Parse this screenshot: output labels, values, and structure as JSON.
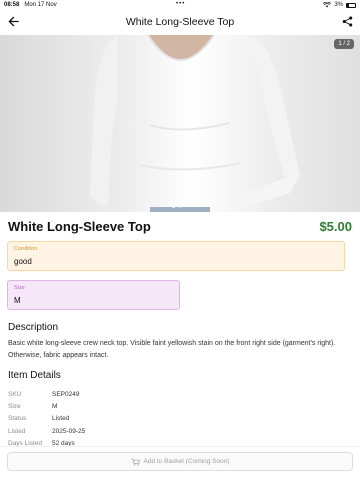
{
  "status_bar": {
    "time": "08:58",
    "date": "Mon 17 Nov",
    "dots": "•••",
    "battery": "3%"
  },
  "app_bar": {
    "title": "White Long-Sleeve Top",
    "back_icon": "arrow-left-icon",
    "share_icon": "share-icon"
  },
  "gallery": {
    "counter": "1 / 2",
    "image_subject": "white long-sleeve crew neck top worn by model"
  },
  "product": {
    "name": "White Long-Sleeve Top",
    "price": "$5.00",
    "price_color": "#2e7d32"
  },
  "condition": {
    "label": "Condition",
    "value": "good"
  },
  "size": {
    "label": "Size",
    "value": "M"
  },
  "description": {
    "title": "Description",
    "text": "Basic white long-sleeve crew neck top. Visible faint yellowish stain on the front right side (garment's right). Otherwise, fabric appears intact."
  },
  "item_details": {
    "title": "Item Details",
    "rows": [
      {
        "key": "SKU",
        "value": "SEP0249"
      },
      {
        "key": "Size",
        "value": "M"
      },
      {
        "key": "Status",
        "value": "Listed"
      },
      {
        "key": "Listed",
        "value": "2025-09-25"
      },
      {
        "key": "Days Listed",
        "value": "52 days"
      }
    ]
  },
  "basket_button": {
    "label": "Add to Basket (Coming Soon)",
    "icon": "cart-icon"
  }
}
